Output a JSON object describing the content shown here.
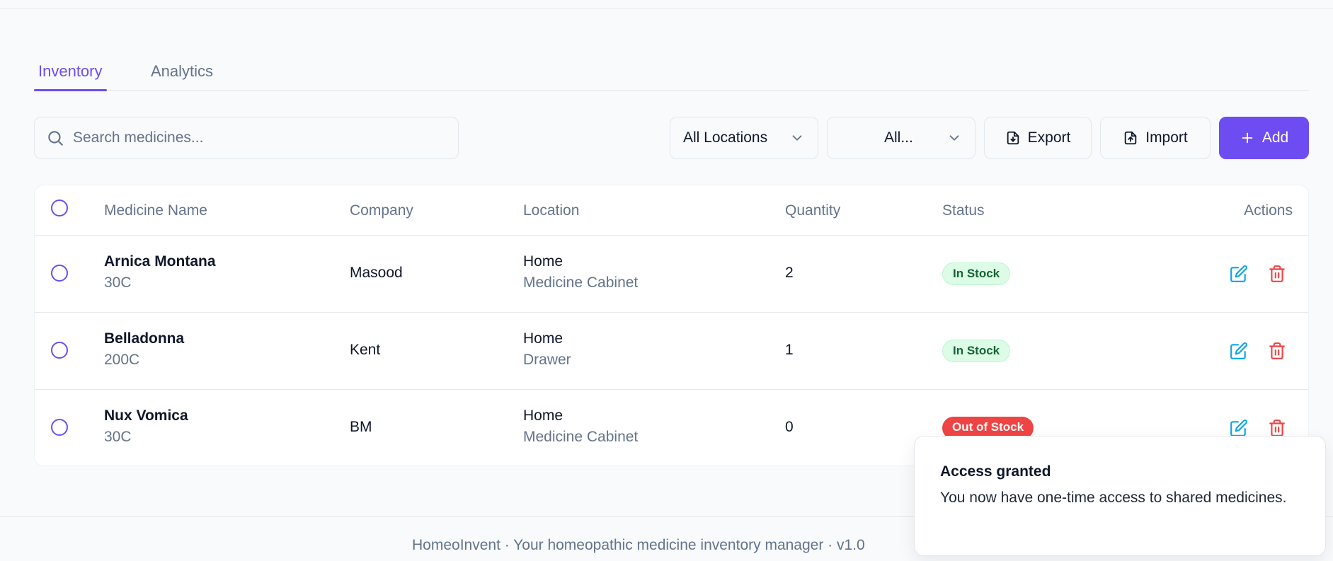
{
  "tabs": [
    {
      "label": "Inventory",
      "active": true
    },
    {
      "label": "Analytics",
      "active": false
    }
  ],
  "search": {
    "placeholder": "Search medicines...",
    "value": ""
  },
  "filters": {
    "location_value": "All Locations",
    "category_value": "All..."
  },
  "toolbar": {
    "export_label": "Export",
    "import_label": "Import",
    "add_label": "Add"
  },
  "table": {
    "headers": {
      "name": "Medicine Name",
      "company": "Company",
      "location": "Location",
      "quantity": "Quantity",
      "status": "Status",
      "actions": "Actions"
    },
    "rows": [
      {
        "name": "Arnica Montana",
        "potency": "30C",
        "company": "Masood",
        "location": "Home",
        "sublocation": "Medicine Cabinet",
        "quantity": "2",
        "status": "In Stock",
        "status_kind": "in"
      },
      {
        "name": "Belladonna",
        "potency": "200C",
        "company": "Kent",
        "location": "Home",
        "sublocation": "Drawer",
        "quantity": "1",
        "status": "In Stock",
        "status_kind": "in"
      },
      {
        "name": "Nux Vomica",
        "potency": "30C",
        "company": "BM",
        "location": "Home",
        "sublocation": "Medicine Cabinet",
        "quantity": "0",
        "status": "Out of Stock",
        "status_kind": "out"
      }
    ]
  },
  "footer": {
    "text": "HomeoInvent · Your homeopathic medicine inventory manager · v1.0"
  },
  "toast": {
    "title": "Access granted",
    "message": "You now have one-time access to shared medicines."
  },
  "colors": {
    "accent": "#6d4df2",
    "edit_icon": "#0ea5e9",
    "delete_icon": "#ef4444",
    "in_stock_bg": "#dcfce7",
    "out_of_stock_bg": "#ef4444"
  },
  "icons": [
    "search-icon",
    "chevron-down-icon",
    "file-download-icon",
    "file-upload-icon",
    "plus-icon",
    "edit-icon",
    "trash-icon"
  ]
}
